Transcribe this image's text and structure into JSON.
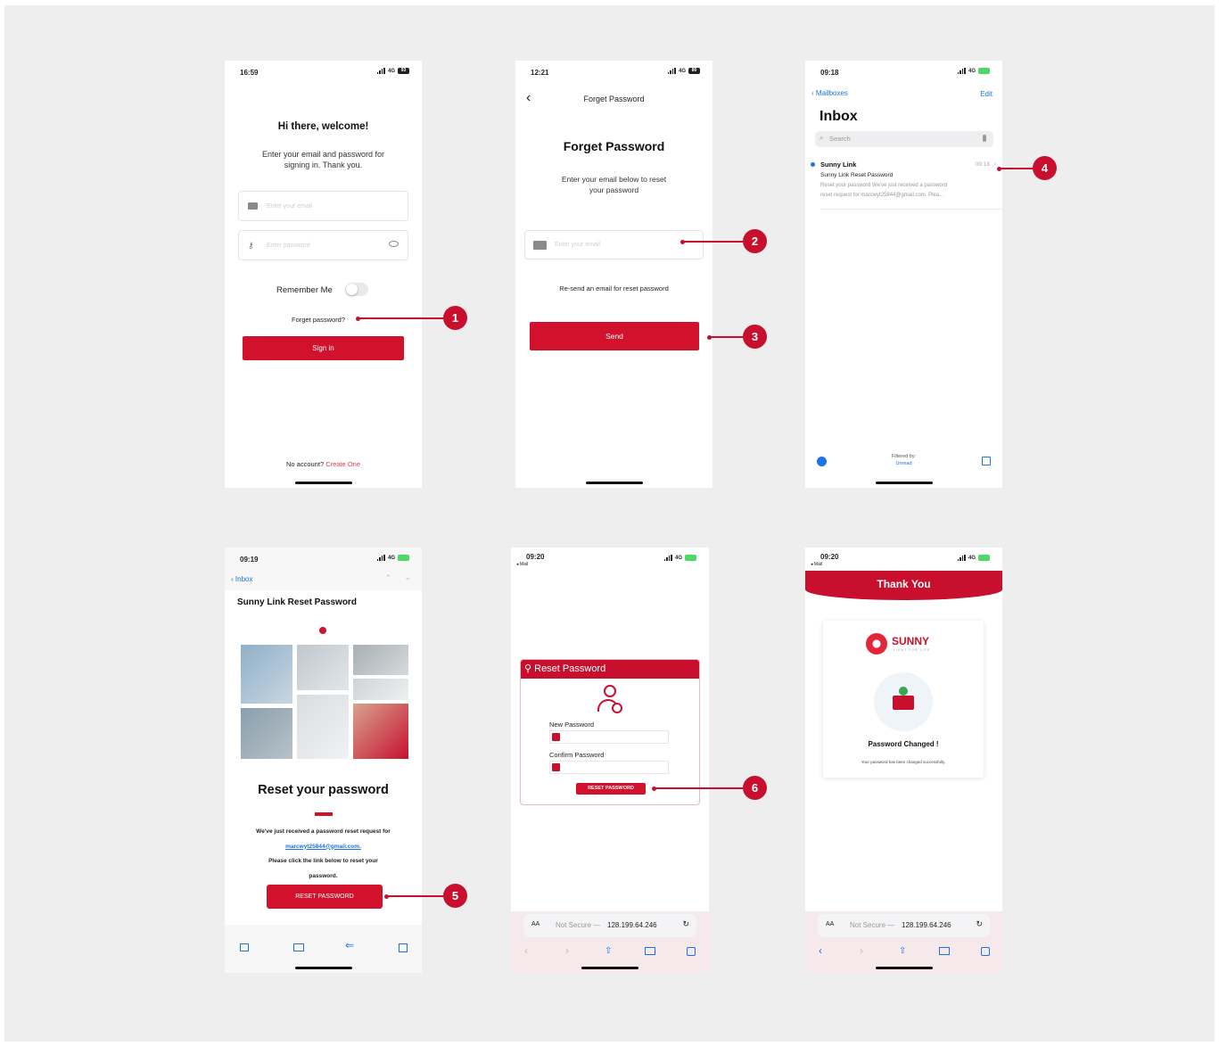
{
  "callouts": [
    "1",
    "2",
    "3",
    "4",
    "5",
    "6"
  ],
  "colors": {
    "brand_red": "#d2112c",
    "background": "#edeeed",
    "link_blue": "#1a73e8"
  },
  "screen1": {
    "time": "16:59",
    "network": "4G",
    "battery": "93",
    "title": "Hi there, welcome!",
    "subtitle_line1": "Enter your email and password for",
    "subtitle_line2": "signing in. Thank you.",
    "email_placeholder": "Enter your email",
    "password_placeholder": "Enter password",
    "remember_me": "Remember Me",
    "forget_link": "Forget password?",
    "sign_in": "Sign in",
    "no_account": "No account?",
    "create_one": "Create One"
  },
  "screen2": {
    "time": "12:21",
    "network": "4G",
    "battery": "80",
    "nav_title": "Forget Password",
    "title": "Forget Password",
    "subtitle_line1": "Enter your email below to reset",
    "subtitle_line2": "your password",
    "email_placeholder": "Enter your email",
    "resend": "Re-send an email for reset password",
    "send": "Send"
  },
  "screen3": {
    "time": "09:18",
    "network": "4G",
    "back": "Mailboxes",
    "edit": "Edit",
    "title": "Inbox",
    "search_placeholder": "Search",
    "mail_sender": "Sunny Link",
    "mail_time": "09:18",
    "mail_subject": "Sunny Link Reset Password",
    "mail_preview_1": "Reset your password We've just received a password",
    "mail_preview_2": "reset request for marcwyt25844@gmail.com. Plea...",
    "filtered_by": "Filtered by:",
    "filter_value": "Unread"
  },
  "screen4": {
    "time": "09:19",
    "network": "4G",
    "back": "Inbox",
    "subject": "Sunny Link Reset Password",
    "heading": "Reset your password",
    "body_line1": "We've just received a password reset request for",
    "email": "marcwyt25844@gmail.com.",
    "body_line2": "Please click the link below to reset your",
    "body_line3": "password.",
    "button": "RESET PASSWORD"
  },
  "screen5": {
    "time": "09:20",
    "back_app": "◂ Mail",
    "network": "4G",
    "card_title": "Reset Password",
    "new_password": "New Password",
    "confirm_password": "Confirm Password",
    "button": "RESET PASSWORD",
    "aa": "AA",
    "address_prefix": "Not Secure —",
    "address_ip": "128.199.64.246"
  },
  "screen6": {
    "time": "09:20",
    "back_app": "◂ Mail",
    "network": "4G",
    "banner": "Thank You",
    "brand": "SUNNY",
    "brand_tagline": "LIGHT FOR LIFE",
    "changed_title": "Password Changed !",
    "changed_text": "Your password has been changed successfully.",
    "aa": "AA",
    "address_prefix": "Not Secure —",
    "address_ip": "128.199.64.246"
  }
}
